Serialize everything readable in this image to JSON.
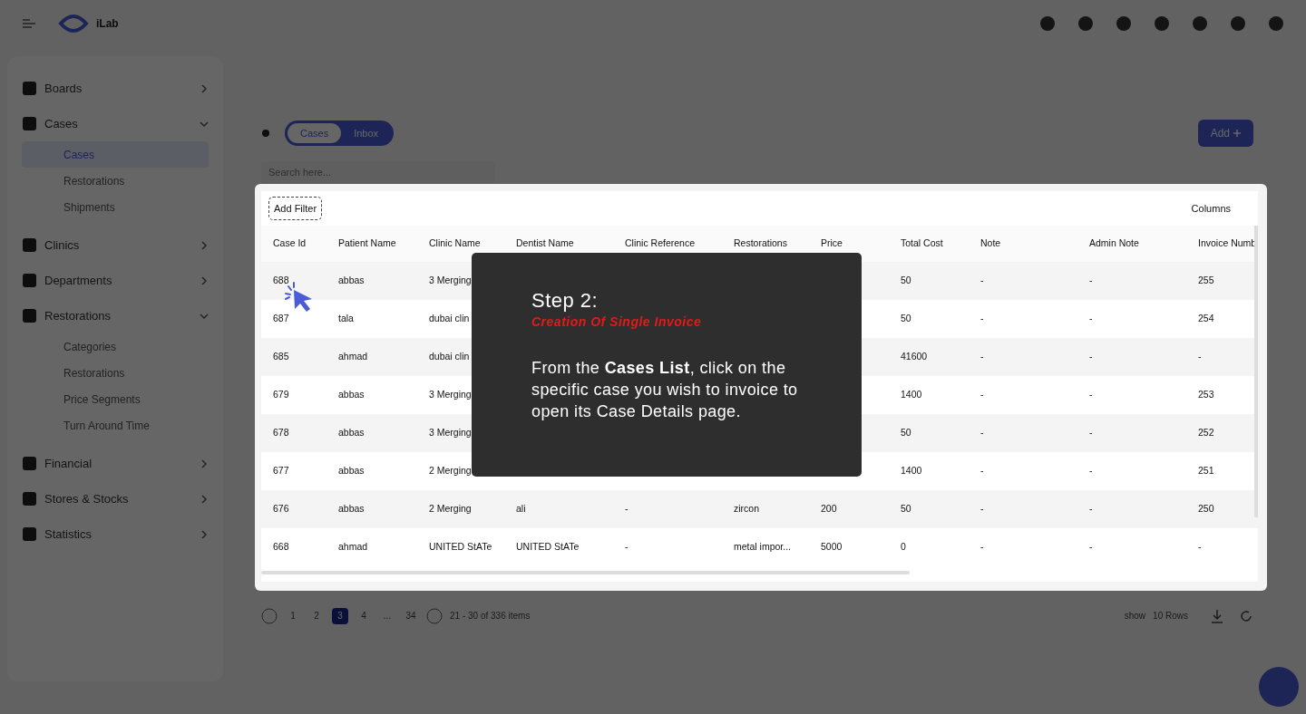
{
  "header": {
    "logo_text": "iLab"
  },
  "sidebar": {
    "items": [
      {
        "label": "Boards",
        "expanded": false
      },
      {
        "label": "Cases",
        "expanded": true,
        "children": [
          {
            "label": "Cases",
            "selected": true
          },
          {
            "label": "Restorations",
            "selected": false
          },
          {
            "label": "Shipments",
            "selected": false
          }
        ]
      },
      {
        "label": "Clinics",
        "expanded": false
      },
      {
        "label": "Departments",
        "expanded": false
      },
      {
        "label": "Restorations",
        "expanded": true,
        "children": [
          {
            "label": "Categories",
            "selected": false
          },
          {
            "label": "Restorations",
            "selected": false
          },
          {
            "label": "Price Segments",
            "selected": false
          },
          {
            "label": "Turn Around Time",
            "selected": false
          }
        ]
      },
      {
        "label": "Financial",
        "expanded": false
      },
      {
        "label": "Stores & Stocks",
        "expanded": false
      },
      {
        "label": "Statistics",
        "expanded": false
      }
    ]
  },
  "tabs": [
    {
      "label": "Cases",
      "selected": true
    },
    {
      "label": "Inbox",
      "selected": false
    }
  ],
  "search": {
    "placeholder": "Search here..."
  },
  "add_button": "Add",
  "table": {
    "add_filter": "Add Filter",
    "columns_button": "Columns",
    "columns": [
      "Case Id",
      "Patient Name",
      "Clinic Name",
      "Dentist Name",
      "Clinic Reference",
      "Restorations",
      "Price",
      "Total Cost",
      "Note",
      "Admin Note",
      "Invoice Numb"
    ],
    "rows": [
      [
        "688",
        "abbas",
        "3 Merging",
        null,
        null,
        null,
        null,
        "50",
        "-",
        "-",
        "255"
      ],
      [
        "687",
        "tala",
        "dubai clin",
        null,
        null,
        null,
        null,
        "50",
        "-",
        "-",
        "254"
      ],
      [
        "685",
        "ahmad",
        "dubai clin",
        null,
        null,
        null,
        null,
        "41600",
        "-",
        "-",
        "-"
      ],
      [
        "679",
        "abbas",
        "3 Merging",
        null,
        null,
        null,
        null,
        "1400",
        "-",
        "-",
        "253"
      ],
      [
        "678",
        "abbas",
        "3 Merging",
        null,
        null,
        null,
        null,
        "50",
        "-",
        "-",
        "252"
      ],
      [
        "677",
        "abbas",
        "2 Merging",
        null,
        null,
        null,
        null,
        "1400",
        "-",
        "-",
        "251"
      ],
      [
        "676",
        "abbas",
        "2 Merging",
        "ali",
        "-",
        "zircon",
        "200",
        "50",
        "-",
        "-",
        "250"
      ],
      [
        "668",
        "ahmad",
        "UNITED StATe",
        "UNITED StATe",
        "-",
        "metal impor...",
        "5000",
        "0",
        "-",
        "-",
        "-"
      ]
    ]
  },
  "tooltip": {
    "title": "Step 2:",
    "subtitle": "Creation Of Single Invoice",
    "body": "From the **Cases List**, click on the specific case you wish to invoice to open its Case Details page."
  },
  "pagination": {
    "pages": [
      {
        "label": "1",
        "selected": false
      },
      {
        "label": "2",
        "selected": false
      },
      {
        "label": "3",
        "selected": true
      },
      {
        "label": "4",
        "selected": false
      },
      {
        "label": "...",
        "selected": false
      },
      {
        "label": "34",
        "selected": false
      }
    ],
    "summary": "21 - 30 of 336 items",
    "show_label": "show",
    "rows_select": "10 Rows"
  }
}
